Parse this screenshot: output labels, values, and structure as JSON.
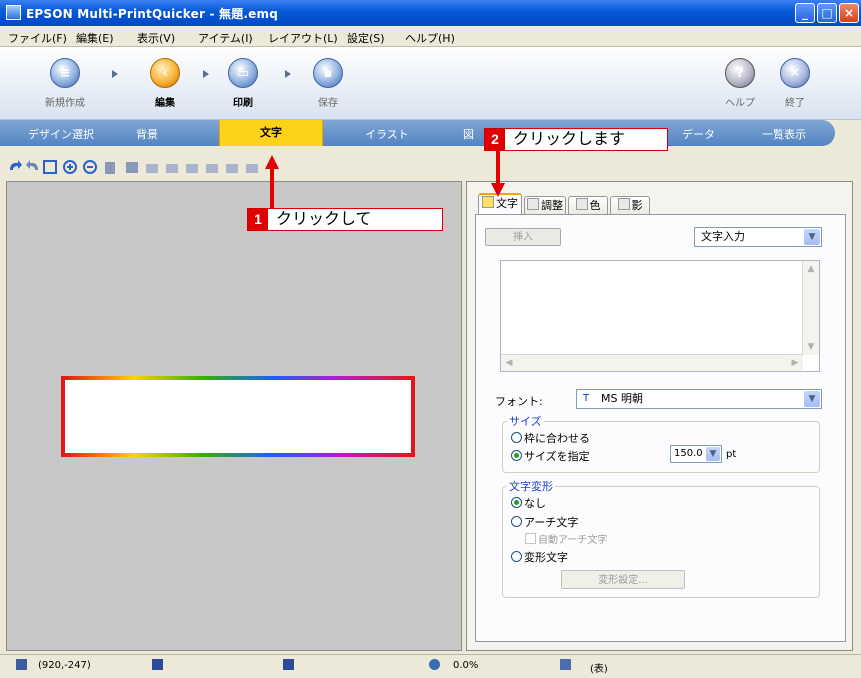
{
  "window": {
    "title": "EPSON Multi-PrintQuicker - 無題.emq",
    "controls": [
      "_",
      "□",
      "×"
    ]
  },
  "menu": [
    "ファイル(F)",
    "編集(E)",
    "表示(V)",
    "アイテム(I)",
    "レイアウト(L)",
    "設定(S)",
    "ヘルプ(H)"
  ],
  "steps": [
    {
      "label": "新規作成",
      "icon": "new-document-icon"
    },
    {
      "label": "編集",
      "icon": "edit-icon"
    },
    {
      "label": "印刷",
      "icon": "print-icon"
    },
    {
      "label": "保存",
      "icon": "save-icon"
    }
  ],
  "right_tools": [
    {
      "label": "ヘルプ",
      "icon": "help-icon",
      "glyph": "?"
    },
    {
      "label": "終了",
      "icon": "exit-icon",
      "glyph": "✕"
    }
  ],
  "tabs": [
    "デザイン選択",
    "背景",
    "文字",
    "イラスト",
    "図",
    "データ",
    "一覧表示"
  ],
  "panel": {
    "tabs": [
      "文字",
      "調整",
      "色",
      "影"
    ],
    "insert_button": "挿入",
    "input_mode": "文字入力",
    "font_label": "フォント:",
    "font_value": "MS 明朝",
    "size_group": "サイズ",
    "size_fit": "枠に合わせる",
    "size_specify": "サイズを指定",
    "size_value": "150.0",
    "size_unit": "pt",
    "transform_group": "文字変形",
    "transform_none": "なし",
    "transform_arch": "アーチ文字",
    "transform_auto_arch": "自動アーチ文字",
    "transform_deform": "変形文字",
    "deform_settings": "変形設定..."
  },
  "status": {
    "coords": "(920,-247)",
    "zoom": "0.0%",
    "side": "(表)"
  },
  "annotations": {
    "step1_num": "1",
    "step1_text": "クリックして",
    "step2_num": "2",
    "step2_text": "クリックします"
  },
  "colors": {
    "title_bar": "#0a5bd8",
    "active_tab": "#ffd21a",
    "annotation_red": "#e00000"
  }
}
